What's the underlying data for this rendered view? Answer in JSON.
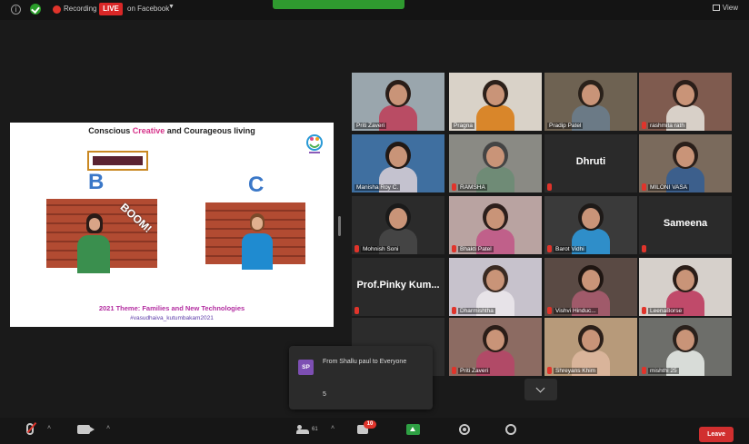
{
  "topbar": {
    "recording_label": "Recording",
    "live_label": "LIVE",
    "stream_label": "on Facebook",
    "view_label": "View"
  },
  "slide": {
    "title_pre": "Conscious ",
    "title_accent": "Creative",
    "title_post": " and Courageous living",
    "letter_b": "B",
    "letter_c": "C",
    "boom_text": "BOOM!",
    "theme": "2021 Theme: Families and New Technologies",
    "hashtag": "#vasudhaiva_kutumbakam2021"
  },
  "participants": [
    {
      "name": "Priti Zaveri",
      "muted": false,
      "spotlight": true,
      "video": true,
      "bg": "#9aa6ad",
      "hair": "#2a1d18",
      "shirt": "#b94c64"
    },
    {
      "name": "Pragna",
      "muted": false,
      "spotlight": false,
      "video": true,
      "bg": "#d9d2c8",
      "hair": "#2c201a",
      "shirt": "#d9862a"
    },
    {
      "name": "Pradip Patel",
      "muted": false,
      "spotlight": false,
      "video": true,
      "bg": "#6e6252",
      "hair": "#2a211a",
      "shirt": "#6b7a86"
    },
    {
      "name": "rashmita rath",
      "muted": true,
      "spotlight": false,
      "video": true,
      "bg": "#7f5b4f",
      "hair": "#2b1e19",
      "shirt": "#d8d0c8"
    },
    {
      "name": "Manisha Roy C.",
      "muted": false,
      "spotlight": false,
      "video": true,
      "bg": "#3f6fa0",
      "hair": "#221915",
      "shirt": "#c4c2cf"
    },
    {
      "name": "RAMSHA",
      "muted": true,
      "spotlight": false,
      "video": true,
      "bg": "#8a8a84",
      "hair": "#444",
      "shirt": "#6f8b76"
    },
    {
      "name": "Dhruti",
      "muted": true,
      "spotlight": false,
      "video": false
    },
    {
      "name": "MILONI VASA",
      "muted": true,
      "spotlight": false,
      "video": true,
      "bg": "#7a6a5c",
      "hair": "#2a1f1a",
      "shirt": "#3c5f8c"
    },
    {
      "name": "Mohnish Soni",
      "muted": true,
      "spotlight": false,
      "video": true,
      "bg": "#2b2b2b",
      "hair": "#1a1a1a",
      "shirt": "#444"
    },
    {
      "name": "Bhakti Patel",
      "muted": true,
      "spotlight": false,
      "video": true,
      "bg": "#b9a3a1",
      "hair": "#2c1f1c",
      "shirt": "#c0608a"
    },
    {
      "name": "Barot Vidhi",
      "muted": true,
      "spotlight": false,
      "video": true,
      "bg": "#3a3a3a",
      "hair": "#1e1a18",
      "shirt": "#2f8ec9"
    },
    {
      "name": "Sameena",
      "muted": true,
      "spotlight": false,
      "video": false
    },
    {
      "name": "Prof.Pinky Kum...",
      "muted": true,
      "spotlight": false,
      "video": false
    },
    {
      "name": "Dharmishtha",
      "muted": true,
      "spotlight": false,
      "video": true,
      "bg": "#c7c2cc",
      "hair": "#3a2a22",
      "shirt": "#e7e3e8"
    },
    {
      "name": "Vishvi Hinduc...",
      "muted": true,
      "spotlight": false,
      "video": true,
      "bg": "#5a4a44",
      "hair": "#1f1612",
      "shirt": "#a05a6a"
    },
    {
      "name": "LeenaBorse",
      "muted": true,
      "spotlight": false,
      "video": true,
      "bg": "#d6d0cb",
      "hair": "#2a1d18",
      "shirt": "#c04a6a"
    },
    {
      "name": "",
      "muted": true,
      "spotlight": false,
      "video": true,
      "bg": "#2c2c2c",
      "hair": "#2c2c2c",
      "shirt": "#2c2c2c"
    },
    {
      "name": "Priti Zaveri",
      "muted": true,
      "spotlight": false,
      "video": true,
      "bg": "#8c6b62",
      "hair": "#2a1d18",
      "shirt": "#b14a67"
    },
    {
      "name": "Shreyans Khim",
      "muted": true,
      "spotlight": false,
      "video": true,
      "bg": "#b79a7a",
      "hair": "#2b1f19",
      "shirt": "#d9b49a"
    },
    {
      "name": "mishthi 25",
      "muted": true,
      "spotlight": false,
      "video": true,
      "bg": "#6d6e6a",
      "hair": "#2a211c",
      "shirt": "#d8dcd8"
    }
  ],
  "chat": {
    "avatar": "SP",
    "from_text": "From Shallu paul to Everyone",
    "message": "5"
  },
  "toolbar": {
    "participant_count": "61",
    "chat_badge": "10",
    "leave_label": "Leave"
  }
}
